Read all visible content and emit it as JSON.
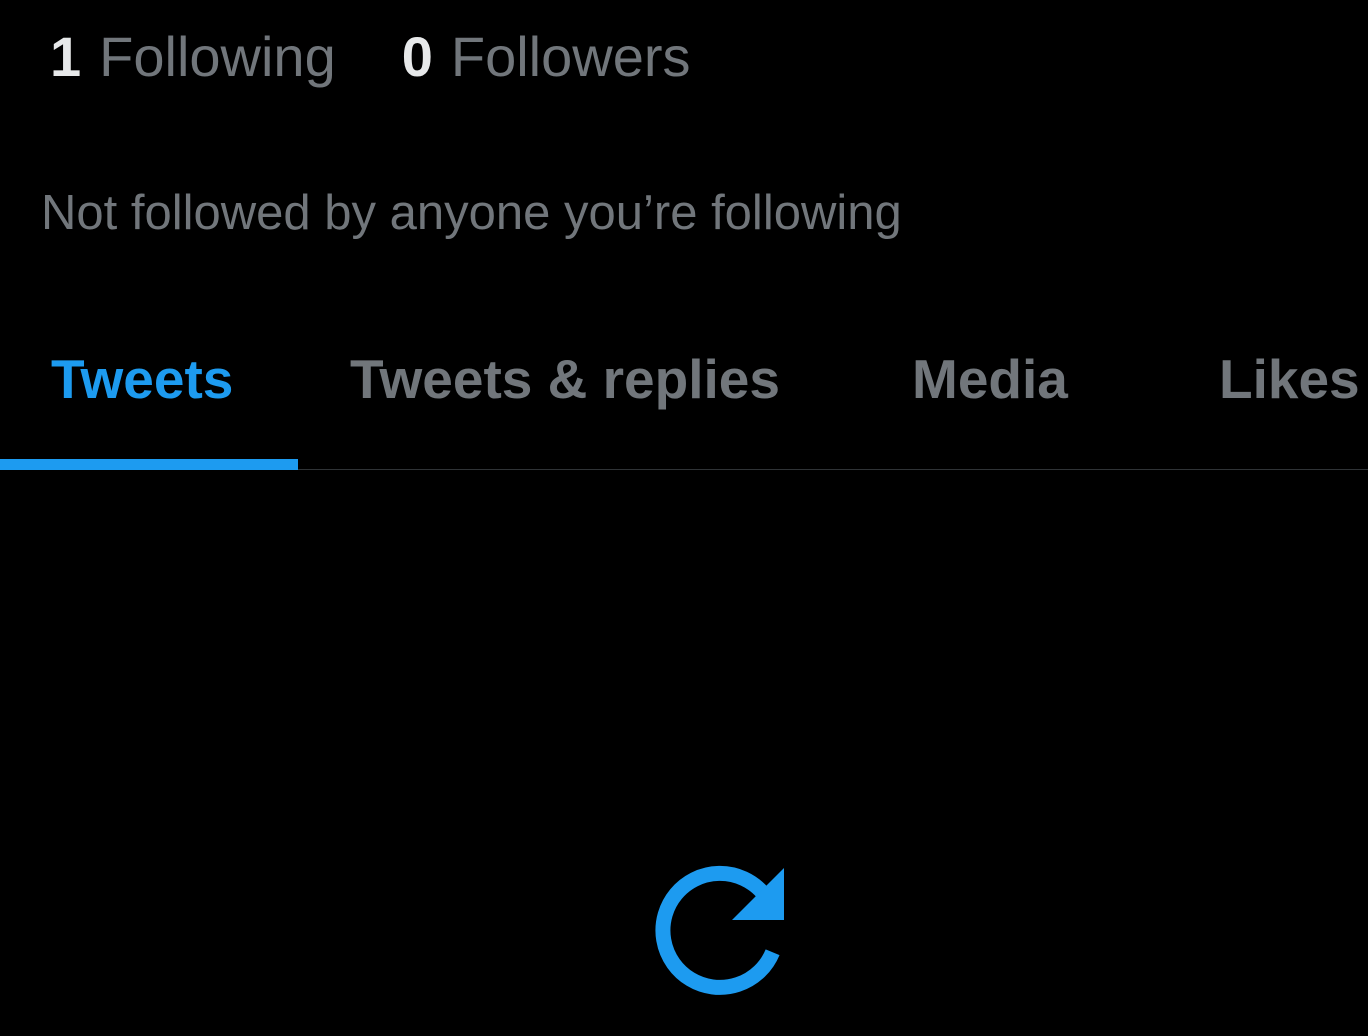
{
  "stats": {
    "following_count": "1",
    "following_label": "Following",
    "followers_count": "0",
    "followers_label": "Followers"
  },
  "followed_by_text": "Not followed by anyone you’re following",
  "tabs": [
    {
      "label": "Tweets",
      "active": true
    },
    {
      "label": "Tweets & replies",
      "active": false
    },
    {
      "label": "Media",
      "active": false
    },
    {
      "label": "Likes",
      "active": false
    }
  ],
  "icons": {
    "retry": "refresh-icon"
  },
  "colors": {
    "accent": "#1d9bf0",
    "background": "#000000",
    "primary_text": "#e7e9ea",
    "secondary_text": "#71767b",
    "divider": "#2f3336"
  }
}
